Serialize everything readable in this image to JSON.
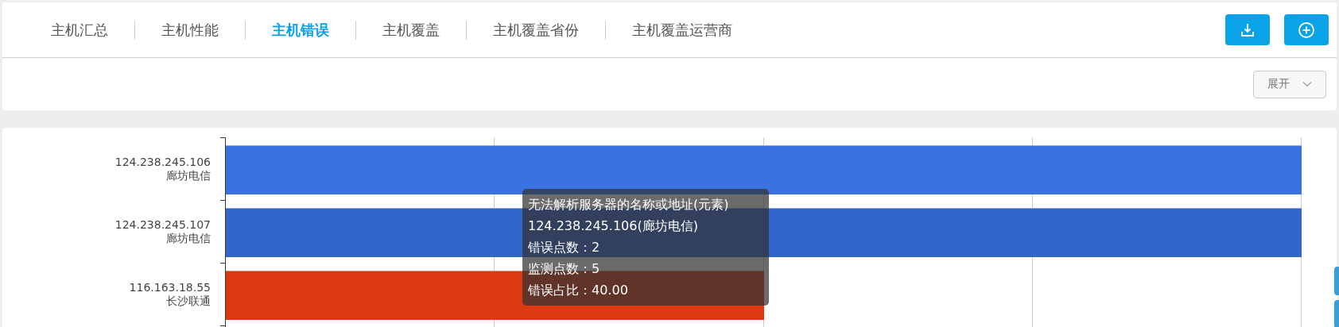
{
  "tabs": [
    {
      "label": "主机汇总",
      "selected": false
    },
    {
      "label": "主机性能",
      "selected": false
    },
    {
      "label": "主机错误",
      "selected": true
    },
    {
      "label": "主机覆盖",
      "selected": false
    },
    {
      "label": "主机覆盖省份",
      "selected": false
    },
    {
      "label": "主机覆盖运营商",
      "selected": false
    }
  ],
  "filter": {
    "expand_button": "展开"
  },
  "chart": {
    "rows": [
      {
        "ip": "124.238.245.106",
        "isp": "廊坊电信",
        "color": "#3a72e0"
      },
      {
        "ip": "124.238.245.107",
        "isp": "廊坊电信",
        "color": "#3366cc"
      },
      {
        "ip": "116.163.18.55",
        "isp": "长沙联通",
        "color": "#dc3912"
      }
    ]
  },
  "tooltip": {
    "title": "无法解析服务器的名称或地址(元素)",
    "host": "124.238.245.106(廊坊电信)",
    "lines": [
      "错误点数：2",
      "监测点数：5",
      "错误占比：40.00"
    ]
  }
}
